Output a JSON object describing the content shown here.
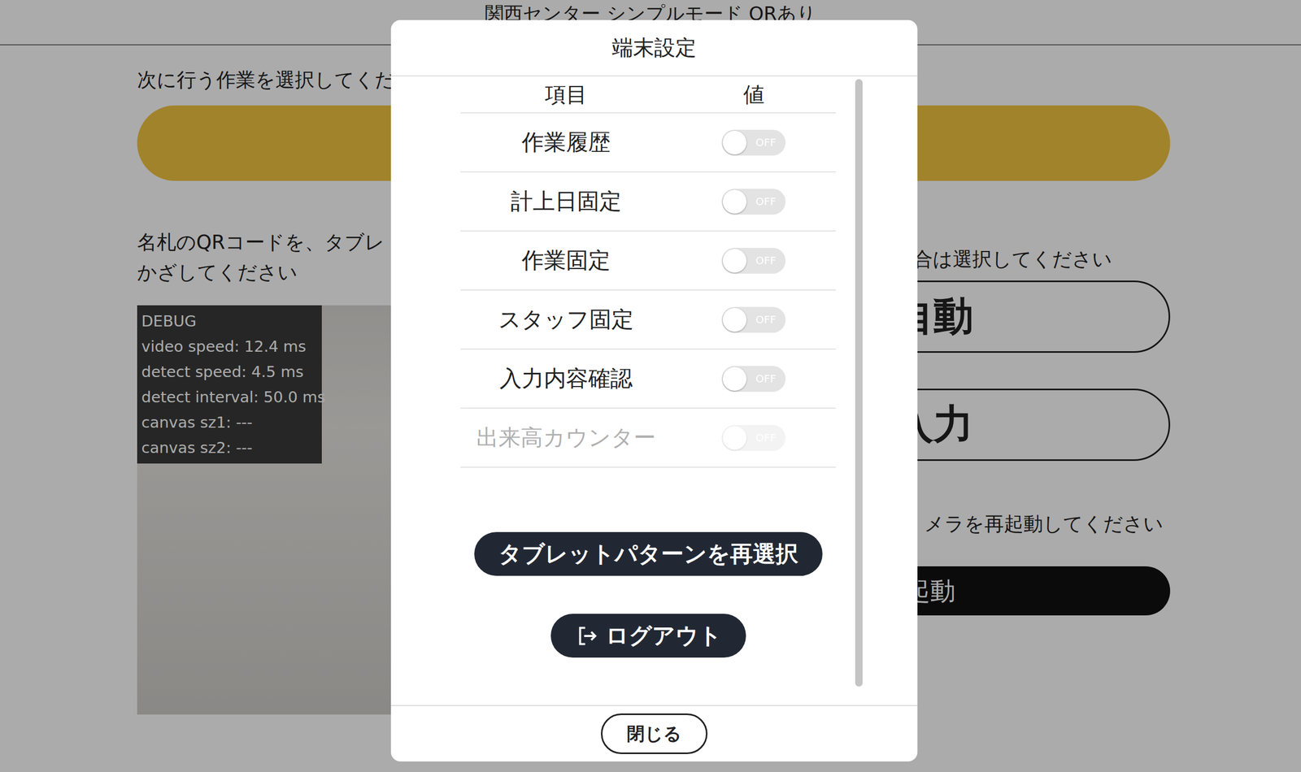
{
  "page": {
    "title": "関西センター シンプルモード QRあり",
    "prompt": "次に行う作業を選択してくだ",
    "qr_hint": [
      "名札のQRコードを、タブレ",
      "かざしてください"
    ],
    "debug": [
      "DEBUG",
      "video speed: 12.4 ms",
      "detect speed: 4.5 ms",
      "detect interval: 50.0 ms",
      "canvas sz1: ---",
      "canvas sz2: ---"
    ],
    "right_hint": "合は選択してください",
    "options": [
      "自動",
      "入力"
    ],
    "camera_hint": "メラを再起動してください",
    "restart_button": "再起動"
  },
  "dialog": {
    "title": "端末設定",
    "columns": [
      "項目",
      "値"
    ],
    "settings": [
      {
        "label": "作業履歴",
        "on": false,
        "disabled": false,
        "value": "OFF"
      },
      {
        "label": "計上日固定",
        "on": false,
        "disabled": false,
        "value": "OFF"
      },
      {
        "label": "作業固定",
        "on": false,
        "disabled": false,
        "value": "OFF"
      },
      {
        "label": "スタッフ固定",
        "on": false,
        "disabled": false,
        "value": "OFF"
      },
      {
        "label": "入力内容確認",
        "on": false,
        "disabled": false,
        "value": "OFF"
      },
      {
        "label": "出来高カウンター",
        "on": false,
        "disabled": true,
        "value": "OFF"
      }
    ],
    "reselect_button": "タブレットパターンを再選択",
    "logout_button": "ログアウト",
    "close_button": "閉じる"
  }
}
